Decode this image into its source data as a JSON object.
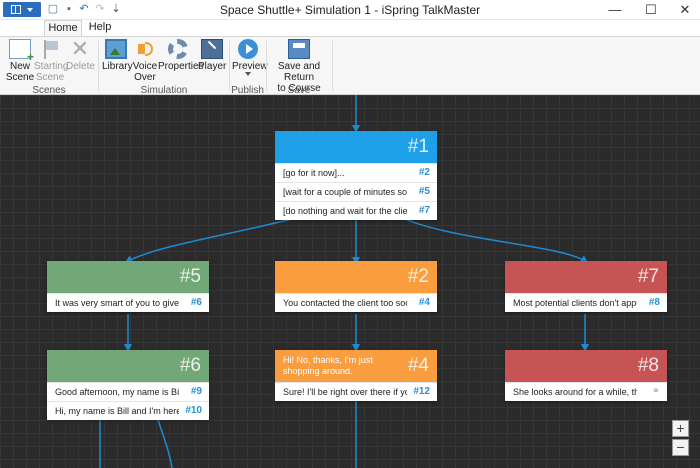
{
  "window": {
    "title": "Space Shuttle+ Simulation 1 - iSpring TalkMaster",
    "controls": [
      "minimize",
      "maximize",
      "close"
    ]
  },
  "quick_access": [
    "new-document-icon",
    "save-icon",
    "undo-icon",
    "redo-icon",
    "customize-icon"
  ],
  "tabs": [
    {
      "label": "Home",
      "active": true
    },
    {
      "label": "Help",
      "active": false
    }
  ],
  "ribbon": {
    "groups": [
      {
        "label": "Scenes",
        "buttons": [
          {
            "label": "New\nScene",
            "icon": "new-scene-icon",
            "enabled": true
          },
          {
            "label": "Starting\nScene",
            "icon": "flag-icon",
            "enabled": false
          },
          {
            "label": "Delete",
            "icon": "delete-icon",
            "enabled": false
          }
        ]
      },
      {
        "label": "Simulation",
        "buttons": [
          {
            "label": "Library",
            "icon": "library-icon",
            "enabled": true
          },
          {
            "label": "Voice\nOver",
            "icon": "speaker-icon",
            "enabled": true
          },
          {
            "label": "Properties",
            "icon": "gear-icon",
            "enabled": true
          },
          {
            "label": "Player",
            "icon": "player-icon",
            "enabled": true
          }
        ]
      },
      {
        "label": "Publish",
        "buttons": [
          {
            "label": "Preview",
            "icon": "play-icon",
            "enabled": true,
            "dropdown": true
          }
        ]
      },
      {
        "label": "Save",
        "buttons": [
          {
            "label": "Save and Return\nto Course",
            "icon": "save-return-icon",
            "enabled": true
          }
        ]
      }
    ]
  },
  "colors": {
    "blue": "#1ea0e8",
    "green": "#72a878",
    "orange": "#f99d3e",
    "red": "#c75454",
    "ref": "#2a8fd8"
  },
  "scenes": {
    "s1": {
      "id": "#1",
      "color": "blue",
      "text": "",
      "replies": [
        {
          "text": "[go for it now]...",
          "ref": "#2"
        },
        {
          "text": "[wait for a couple of minutes so that th...",
          "ref": "#5"
        },
        {
          "text": "[do nothing and wait for the client to c...",
          "ref": "#7"
        }
      ]
    },
    "s5": {
      "id": "#5",
      "color": "green",
      "text": "",
      "replies": [
        {
          "text": "It was very smart of you to give the clie...",
          "ref": "#6"
        }
      ]
    },
    "s2": {
      "id": "#2",
      "color": "orange",
      "text": "",
      "replies": [
        {
          "text": "You contacted the client too soon. She ...",
          "ref": "#4"
        }
      ]
    },
    "s7": {
      "id": "#7",
      "color": "red",
      "text": "",
      "replies": [
        {
          "text": "Most potential clients don't approach a...",
          "ref": "#8"
        }
      ]
    },
    "s6": {
      "id": "#6",
      "color": "green",
      "text": "",
      "replies": [
        {
          "text": "Good afternoon, my name is Bill. Welc...",
          "ref": "#9"
        },
        {
          "text": "Hi, my name is Bill and I'm here to hel...",
          "ref": "#10"
        }
      ]
    },
    "s4": {
      "id": "#4",
      "color": "orange",
      "text": "Hi! No, thanks, I'm just shopping around.",
      "replies": [
        {
          "text": "Sure! I'll be right over there if you have...",
          "ref": "#12"
        }
      ]
    },
    "s8": {
      "id": "#8",
      "color": "red",
      "text": "",
      "replies": [
        {
          "text": "She looks around for a while, then appr...",
          "ref": "",
          "icon": "link-icon"
        }
      ]
    }
  },
  "zoom": {
    "in_label": "+",
    "out_label": "−"
  }
}
